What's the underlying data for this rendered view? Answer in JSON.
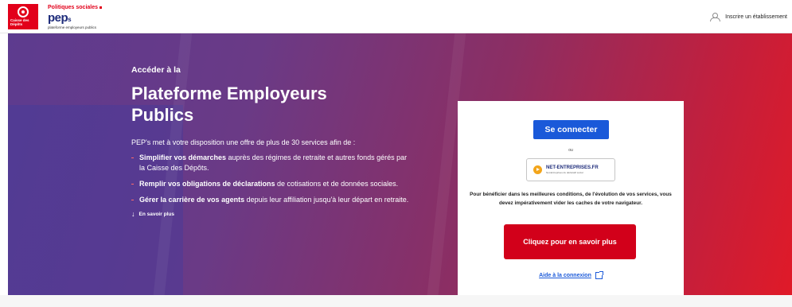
{
  "header": {
    "logo_text": "Caisse des Dépôts",
    "brand_tagline_top": "Politiques sociales",
    "brand_name": "pep",
    "brand_suffix": "s",
    "brand_tagline_bottom": "plateforme employeurs publics",
    "enroll_label": "Inscrire un établissement",
    "enroll_icon": "user-add-icon"
  },
  "hero": {
    "pre_title": "Accéder à la",
    "title": "Plateforme Employeurs Publics",
    "intro": "PEP's met à votre disposition une offre de plus de 30 services afin de :",
    "items": [
      {
        "strong": "Simplifier vos démarches",
        "rest": " auprès des régimes de retraite et autres fonds gérés par la Caisse des Dépôts."
      },
      {
        "strong": "Remplir vos obligations de déclarations",
        "rest": " de cotisations et de données sociales."
      },
      {
        "strong": "Gérer la carrière de vos agents",
        "rest": " depuis leur affiliation jusqu'à leur départ en retraite."
      }
    ],
    "more_label": "En savoir plus",
    "more_icon": "arrow-down-icon"
  },
  "login": {
    "connect_label": "Se connecter",
    "or_label": "ou",
    "net_title": "NET-ENTREPRISES.FR",
    "net_subtitle": "Net-Entreprises du déclaratif social",
    "note": "Pour bénéficier dans les meilleures conditions, de l'évolution de vos services, vous devez impérativement vider les caches de votre navigateur.",
    "more_button": "Cliquez pour en savoir plus",
    "help_label": "Aide à la connexion",
    "help_icon": "external-link-icon"
  },
  "colors": {
    "primary_blue": "#1a59d9",
    "brand_red": "#d2001a",
    "hero_start": "#5d3b8f",
    "hero_end": "#e01a28"
  }
}
